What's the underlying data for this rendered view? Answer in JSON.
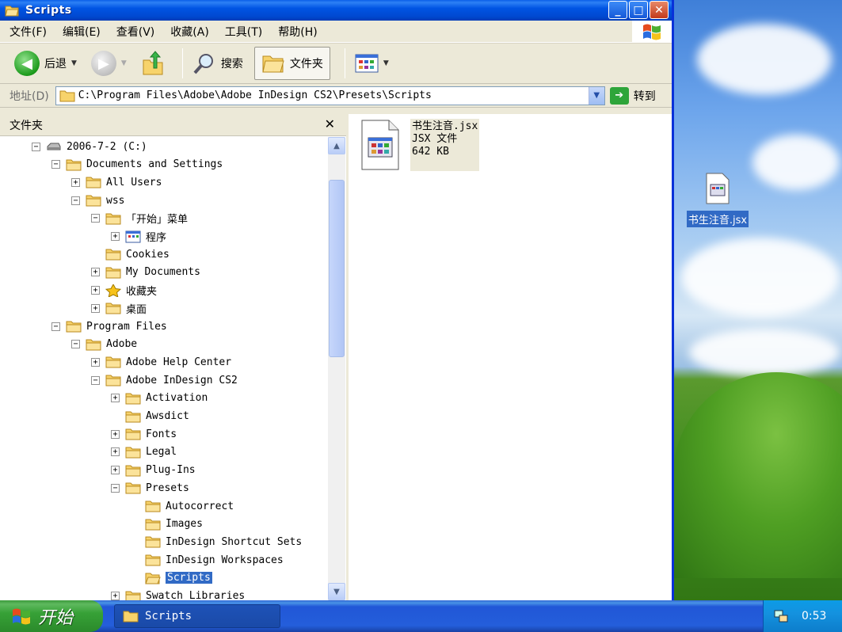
{
  "window": {
    "title": "Scripts",
    "controls": {
      "minimize": "_",
      "maximize": "□",
      "close": "✕"
    }
  },
  "menu": [
    "文件(F)",
    "编辑(E)",
    "查看(V)",
    "收藏(A)",
    "工具(T)",
    "帮助(H)"
  ],
  "toolbar": {
    "back_label": "后退",
    "search_label": "搜索",
    "folders_label": "文件夹"
  },
  "address": {
    "label": "地址(D)",
    "path": "C:\\Program Files\\Adobe\\Adobe InDesign CS2\\Presets\\Scripts",
    "go_label": "转到"
  },
  "folders_pane": {
    "title": "文件夹",
    "close": "✕",
    "tree": [
      {
        "label": "2006-7-2 (C:)",
        "expander": "−",
        "icon": "drive-icon"
      },
      {
        "label": "Documents and Settings",
        "expander": "−",
        "icon": "folder-icon"
      },
      {
        "label": "All Users",
        "expander": "+",
        "icon": "folder-icon"
      },
      {
        "label": "wss",
        "expander": "−",
        "icon": "folder-icon"
      },
      {
        "label": "「开始」菜单",
        "expander": "−",
        "icon": "folder-icon"
      },
      {
        "label": "程序",
        "expander": "+",
        "icon": "programs-icon"
      },
      {
        "label": "Cookies",
        "expander": "",
        "icon": "folder-icon"
      },
      {
        "label": "My Documents",
        "expander": "+",
        "icon": "folder-icon"
      },
      {
        "label": "收藏夹",
        "expander": "+",
        "icon": "favorites-star-icon"
      },
      {
        "label": "桌面",
        "expander": "+",
        "icon": "folder-icon"
      },
      {
        "label": "Program Files",
        "expander": "−",
        "icon": "folder-icon"
      },
      {
        "label": "Adobe",
        "expander": "−",
        "icon": "folder-icon"
      },
      {
        "label": "Adobe Help Center",
        "expander": "+",
        "icon": "folder-icon"
      },
      {
        "label": "Adobe InDesign CS2",
        "expander": "−",
        "icon": "folder-icon"
      },
      {
        "label": "Activation",
        "expander": "+",
        "icon": "folder-icon"
      },
      {
        "label": "Awsdict",
        "expander": "",
        "icon": "folder-icon"
      },
      {
        "label": "Fonts",
        "expander": "+",
        "icon": "folder-icon"
      },
      {
        "label": "Legal",
        "expander": "+",
        "icon": "folder-icon"
      },
      {
        "label": "Plug-Ins",
        "expander": "+",
        "icon": "folder-icon"
      },
      {
        "label": "Presets",
        "expander": "−",
        "icon": "folder-icon"
      },
      {
        "label": "Autocorrect",
        "expander": "",
        "icon": "folder-icon"
      },
      {
        "label": "Images",
        "expander": "",
        "icon": "folder-icon"
      },
      {
        "label": "InDesign Shortcut Sets",
        "expander": "",
        "icon": "folder-icon"
      },
      {
        "label": "InDesign Workspaces",
        "expander": "",
        "icon": "folder-icon"
      },
      {
        "label": "Scripts",
        "expander": "",
        "icon": "folder-open-icon",
        "selected": true
      },
      {
        "label": "Swatch Libraries",
        "expander": "+",
        "icon": "folder-icon"
      }
    ]
  },
  "content": {
    "file": {
      "name": "书生注音.jsx",
      "type": "JSX 文件",
      "size": "642 KB"
    }
  },
  "desktop": {
    "icon_label": "书生注音.jsx"
  },
  "taskbar": {
    "start_label": "开始",
    "task_label": "Scripts",
    "clock": "0:53"
  },
  "colors": {
    "selection": "#316ac5",
    "titlebar": "#0054e3",
    "taskbar": "#245edb",
    "start": "#37a137"
  }
}
